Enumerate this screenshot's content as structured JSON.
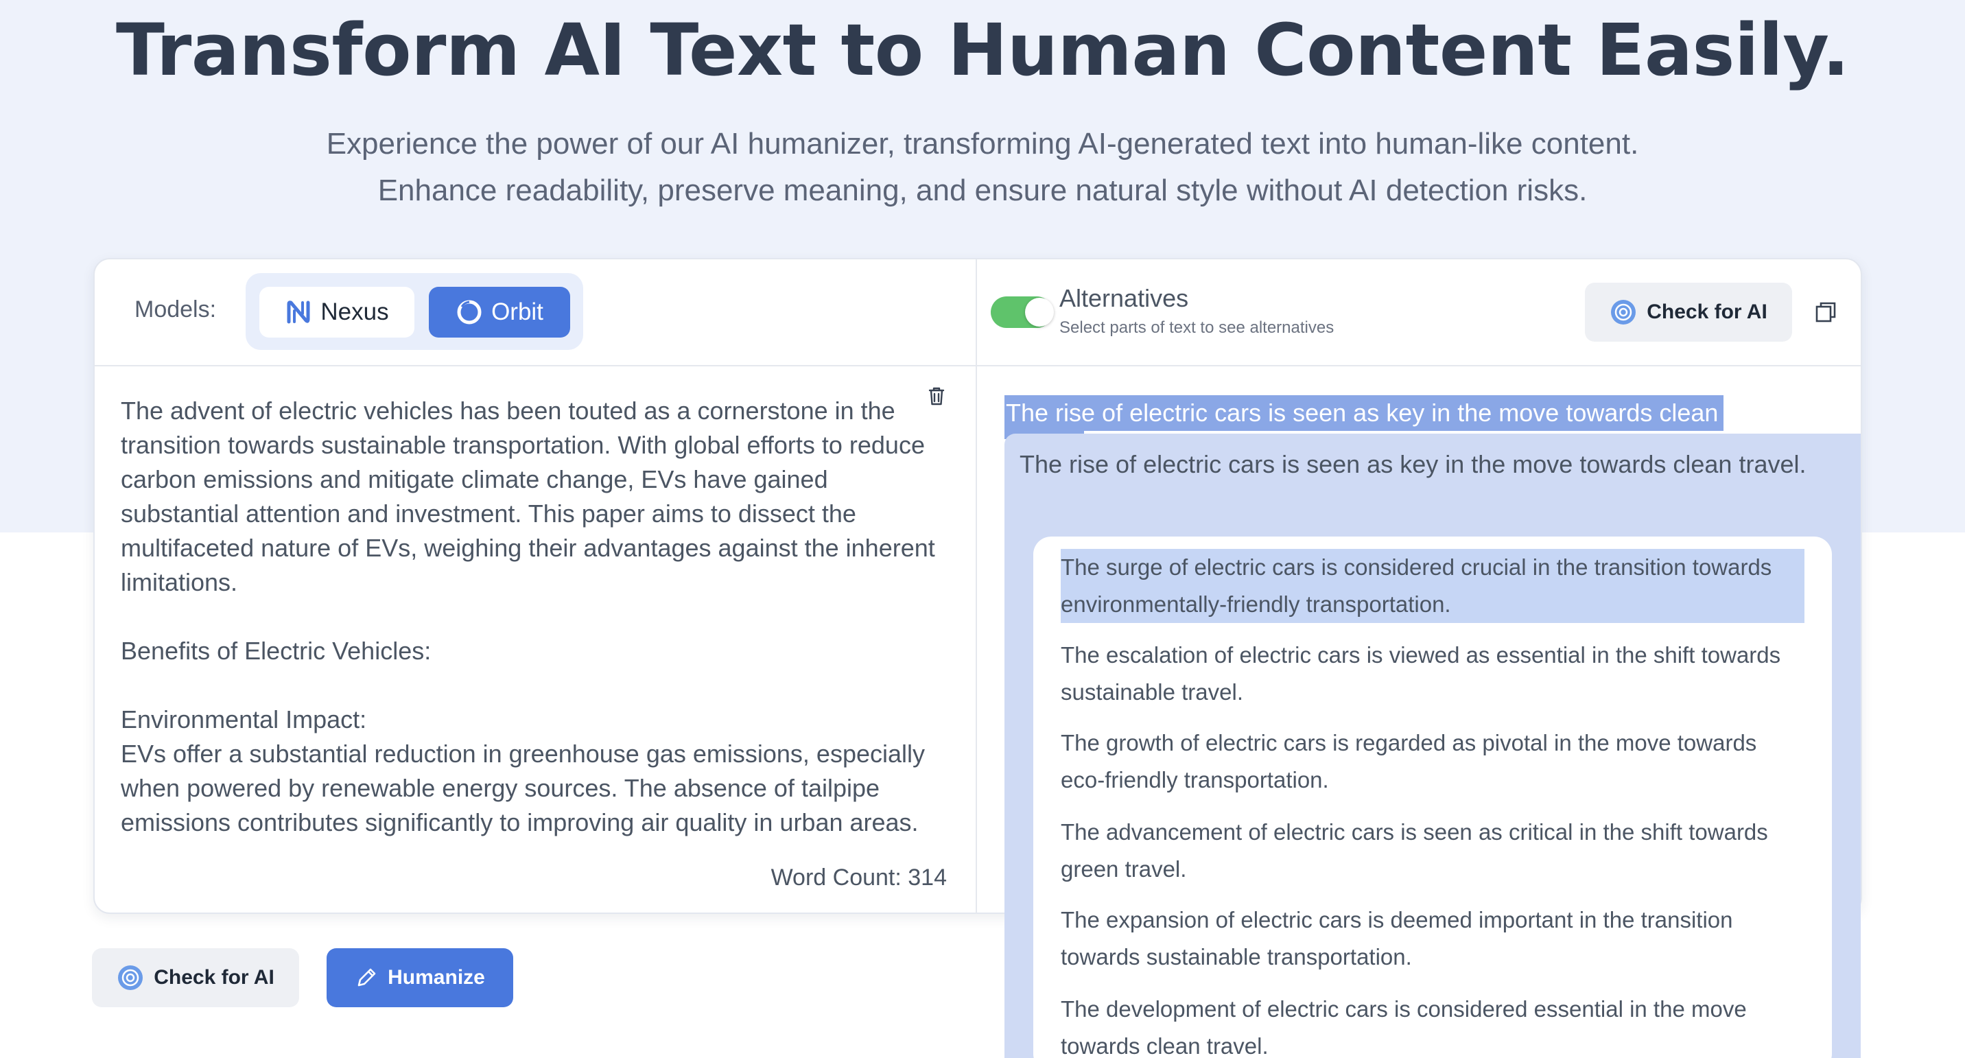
{
  "hero": {
    "title": "Transform AI Text to Human Content Easily.",
    "subtitle_line1": "Experience the power of our AI humanizer, transforming AI-generated text into human-like content.",
    "subtitle_line2": "Enhance readability, preserve meaning, and ensure natural style without AI detection risks."
  },
  "models": {
    "label": "Models:",
    "options": [
      {
        "name": "Nexus",
        "icon": "nexus-logo-icon",
        "selected": false
      },
      {
        "name": "Orbit",
        "icon": "orbit-logo-icon",
        "selected": true
      }
    ],
    "accent": "#4978dd"
  },
  "input": {
    "paragraph1": "The advent of electric vehicles has been touted as a cornerstone in the transition towards sustainable transportation. With global efforts to reduce carbon emissions and mitigate climate change, EVs have gained substantial attention and investment. This paper aims to dissect the multifaceted nature of EVs, weighing their advantages against the inherent limitations.",
    "heading1": "Benefits of Electric Vehicles:",
    "heading2": "Environmental Impact:",
    "paragraph2": "EVs offer a substantial reduction in greenhouse gas emissions, especially when powered by renewable energy sources. The absence of tailpipe emissions contributes significantly to improving air quality in urban areas.",
    "word_count": "Word Count: 314"
  },
  "actions": {
    "check_label": "Check for AI",
    "humanize_label": "Humanize"
  },
  "output": {
    "toggle_on": true,
    "toggle_color": "#5fc36b",
    "alternatives_title": "Alternatives",
    "alternatives_hint": "Select parts of text to see alternatives",
    "check_label": "Check for AI",
    "selected_sentence": "The rise of electric cars is seen as key in the move towards clean",
    "original_sentence": "The rise of electric cars is seen as key in the move towards clean travel.",
    "alternatives": [
      "The surge of electric cars is considered crucial in the transition towards environmentally-friendly transportation.",
      "The escalation of electric cars is viewed as essential in the shift towards sustainable travel.",
      "The growth of electric cars is regarded as pivotal in the move towards eco-friendly transportation.",
      "The advancement of electric cars is seen as critical in the shift towards green travel.",
      "The expansion of electric cars is deemed important in the transition towards sustainable transportation.",
      "The development of electric cars is considered essential in the move towards clean travel."
    ]
  }
}
